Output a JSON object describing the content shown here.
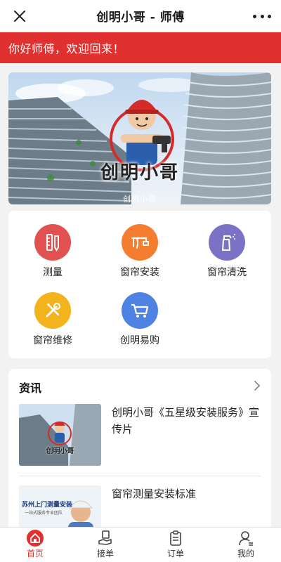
{
  "window": {
    "title": "创明小哥 - 师傅"
  },
  "welcome": {
    "text": "你好师傅，欢迎回来！"
  },
  "hero": {
    "brand_text": "创明小哥",
    "watermark": "创明小哥"
  },
  "services": [
    {
      "label": "测量",
      "icon": "ruler-pencil-icon",
      "color": "#e25151"
    },
    {
      "label": "窗帘安装",
      "icon": "curtain-rail-icon",
      "color": "#f47d30"
    },
    {
      "label": "窗帘清洗",
      "icon": "spray-bottle-icon",
      "color": "#7b72c6"
    },
    {
      "label": "窗帘维修",
      "icon": "wrench-screwdriver-icon",
      "color": "#f3b31c"
    },
    {
      "label": "创明易购",
      "icon": "shopping-cart-icon",
      "color": "#4f83e3"
    }
  ],
  "news": {
    "title": "资讯",
    "items": [
      {
        "title": "创明小哥《五星级安装服务》宣传片",
        "thumb_text": "创明小哥"
      },
      {
        "title": "窗帘测量安装标准",
        "thumb_text": "苏州上门测量安装",
        "thumb_sub": "一站式服务专业团队"
      }
    ]
  },
  "tabbar": {
    "tabs": [
      {
        "label": "首页",
        "icon": "home-icon",
        "active": true
      },
      {
        "label": "接单",
        "icon": "hand-order-icon",
        "active": false
      },
      {
        "label": "订单",
        "icon": "clipboard-icon",
        "active": false
      },
      {
        "label": "我的",
        "icon": "user-icon",
        "active": false
      }
    ]
  },
  "colors": {
    "accent": "#e0302f",
    "background": "#f2f2f2"
  }
}
